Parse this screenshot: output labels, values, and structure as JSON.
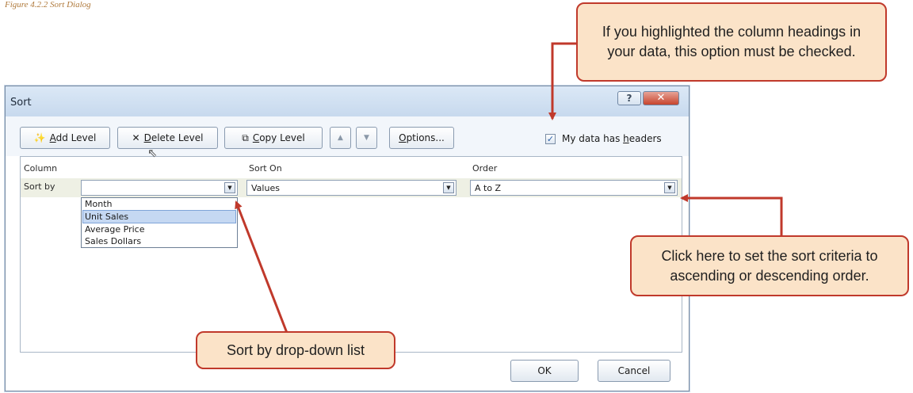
{
  "caption": "Figure 4.2.2 Sort Dialog",
  "dialog": {
    "title": "Sort",
    "help_label": "?",
    "close_label": "✕"
  },
  "toolbar": {
    "add_level": {
      "pre": "",
      "accel": "A",
      "post": "dd Level"
    },
    "delete_level": {
      "pre": "",
      "accel": "D",
      "post": "elete Level"
    },
    "copy_level": {
      "pre": "",
      "accel": "C",
      "post": "opy Level"
    },
    "move_up_label": "▲",
    "move_down_label": "▼",
    "options": {
      "pre": "",
      "accel": "O",
      "post": "ptions..."
    },
    "has_headers": {
      "pre": "My data has ",
      "accel": "h",
      "post": "eaders",
      "checked": true
    }
  },
  "columns": {
    "column_header": "Column",
    "sort_on_header": "Sort On",
    "order_header": "Order"
  },
  "sort_row": {
    "label": "Sort by",
    "column_value": "",
    "sort_on_value": "Values",
    "order_value": "A to Z"
  },
  "dropdown_options": [
    "Month",
    "Unit Sales",
    "Average Price",
    "Sales Dollars"
  ],
  "dropdown_selected": "Unit Sales",
  "buttons": {
    "ok_label": "OK",
    "cancel_label": "Cancel"
  },
  "callouts": {
    "headers_note": "If you highlighted the column headings in your data, this option must be checked.",
    "order_note": "Click here to set the sort criteria to ascending or descending order.",
    "sortby_note": "Sort by drop-down list"
  },
  "colors": {
    "callout_fill": "#fbe3c8",
    "callout_border": "#c0392b",
    "arrow": "#c0392b",
    "selection": "#c5d8f2"
  }
}
